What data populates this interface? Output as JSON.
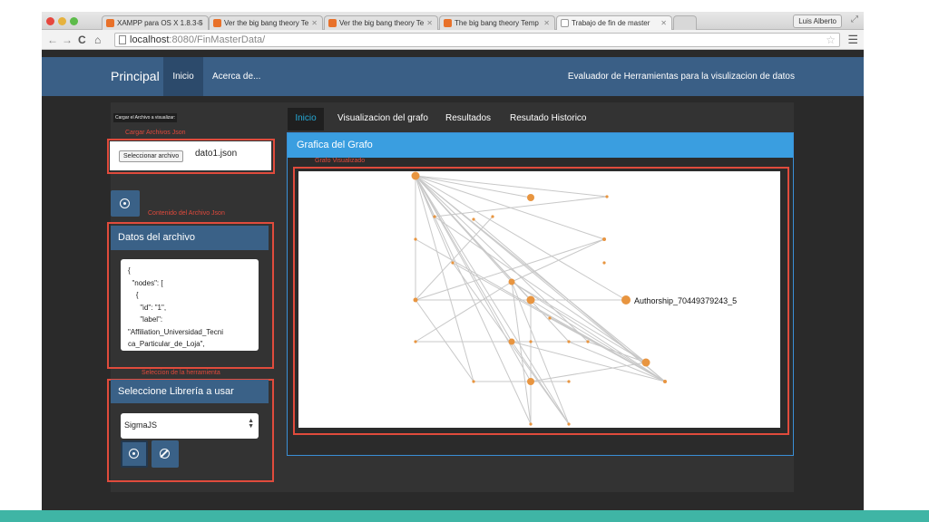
{
  "browser": {
    "tabs": [
      {
        "label": "XAMPP para OS X 1.8.3-5",
        "favicon": "xampp-favicon"
      },
      {
        "label": "Ver the big bang theory Te",
        "favicon": "orange-favicon"
      },
      {
        "label": "Ver the big bang theory Te",
        "favicon": "orange-favicon"
      },
      {
        "label": "The big bang theory Temp",
        "favicon": "orange-favicon"
      },
      {
        "label": "Trabajo de fin de master",
        "favicon": "page-favicon"
      }
    ],
    "user_button": "Luis Alberto",
    "url_host": "localhost",
    "url_rest": ":8080/FinMasterData/"
  },
  "navbar": {
    "brand": "Principal",
    "items": [
      "Inicio",
      "Acerca de..."
    ],
    "title": "Evaluador de Herramientas para la visulizacion de datos"
  },
  "left": {
    "upload_title": "Cargar el Archivo a visualizar:",
    "upload_label": "Cargar Archivos Json",
    "file_button": "Seleccionar archivo",
    "file_name": "dato1.json",
    "content_label": "Contenido del Archivo Json",
    "data_panel_title": "Datos del archivo",
    "json_text": "{\n  \"nodes\": [\n    {\n      \"id\": \"1\",\n      \"label\":\n\"Affiliation_Universidad_Tecni\nca_Particular_de_Loja\",",
    "tool_label": "Seleccion de la herramienta",
    "library_panel_title": "Seleccione Librería a usar",
    "library_selected": "SigmaJS"
  },
  "right": {
    "tabs": [
      "Inicio",
      "Visualizacion del grafo",
      "Resultados",
      "Resutado Historico"
    ],
    "panel_title": "Grafica del Grafo",
    "graph_label": "Grafo Visualizado",
    "node_label": "Authorship_70449379243_5"
  },
  "colors": {
    "navbar": "#3a5f86",
    "panel_head": "#3a6187",
    "graph_head": "#3a9ee0",
    "highlight_red": "#e04b3c",
    "node": "#e89540",
    "active_tab": "#25a8d4"
  },
  "icons": {
    "upload": "circle-upload-icon",
    "cancel": "ban-icon"
  }
}
